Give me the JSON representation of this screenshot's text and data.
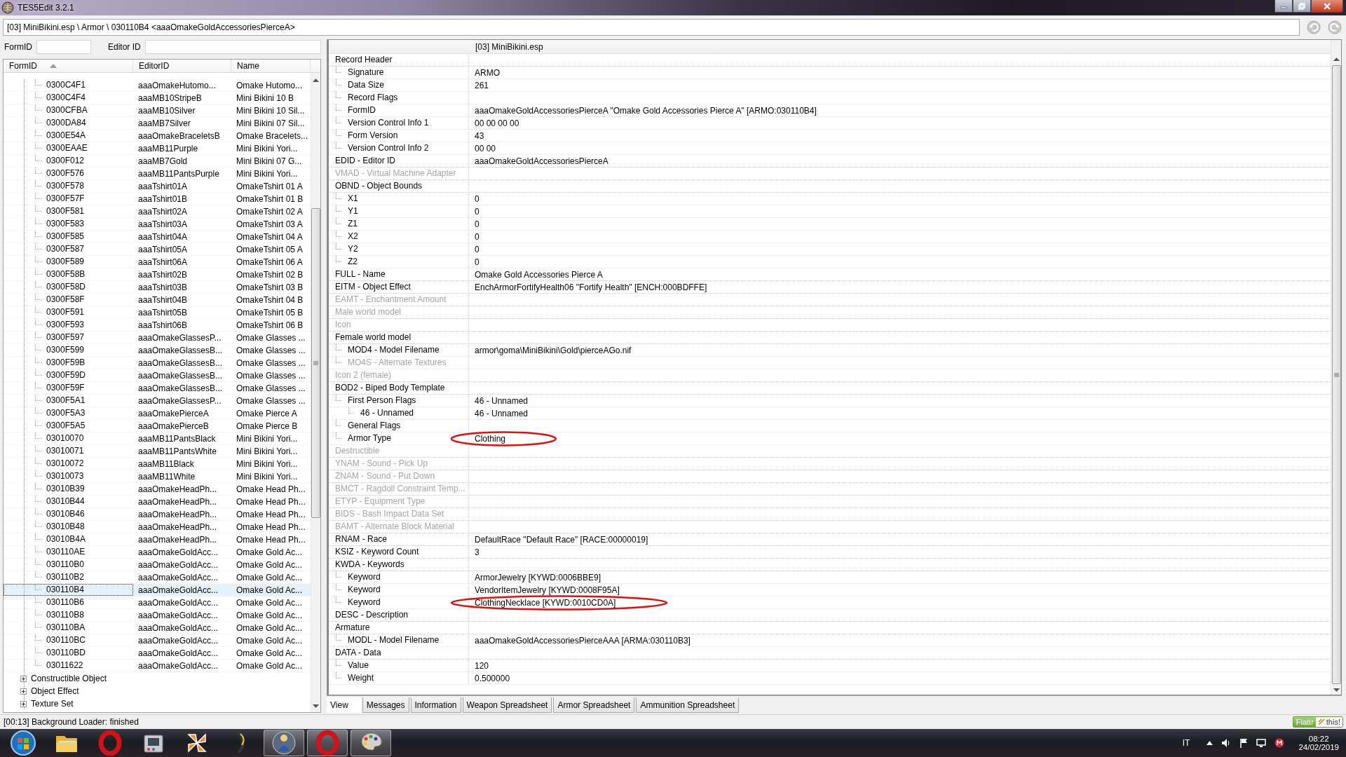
{
  "window": {
    "title": "TES5Edit 3.2.1"
  },
  "path": "[03] MiniBikini.esp \\ Armor \\ 030110B4 <aaaOmakeGoldAccessoriesPierceA>",
  "filters": [
    {
      "label": "FormID"
    },
    {
      "label": "Editor ID"
    }
  ],
  "record_list": {
    "columns": [
      {
        "label": "FormID",
        "sorted": true
      },
      {
        "label": "EditorID",
        "sorted": false
      },
      {
        "label": "Name",
        "sorted": false
      }
    ],
    "rows": [
      {
        "form_id": "0300C4F1",
        "editor_id": "aaaOmakeHutomo...",
        "name": "Omake Hutomo...",
        "selected": false
      },
      {
        "form_id": "0300C4F4",
        "editor_id": "aaaMB10StripeB",
        "name": "Mini Bikini 10 B",
        "selected": false
      },
      {
        "form_id": "0300CFBA",
        "editor_id": "aaaMB10Silver",
        "name": "Mini Bikini 10 Sil...",
        "selected": false
      },
      {
        "form_id": "0300DA84",
        "editor_id": "aaaMB7Silver",
        "name": "Mini Bikini 07 Sil...",
        "selected": false
      },
      {
        "form_id": "0300E54A",
        "editor_id": "aaaOmakeBraceletsB",
        "name": "Omake Bracelets...",
        "selected": false
      },
      {
        "form_id": "0300EAAE",
        "editor_id": "aaaMB11Purple",
        "name": "Mini Bikini Yori...",
        "selected": false
      },
      {
        "form_id": "0300F012",
        "editor_id": "aaaMB7Gold",
        "name": "Mini Bikini 07 G...",
        "selected": false
      },
      {
        "form_id": "0300F576",
        "editor_id": "aaaMB11PantsPurple",
        "name": "Mini Bikini Yori...",
        "selected": false
      },
      {
        "form_id": "0300F578",
        "editor_id": "aaaTshirt01A",
        "name": "OmakeTshirt 01 A",
        "selected": false
      },
      {
        "form_id": "0300F57F",
        "editor_id": "aaaTshirt01B",
        "name": "OmakeTshirt 01 B",
        "selected": false
      },
      {
        "form_id": "0300F581",
        "editor_id": "aaaTshirt02A",
        "name": "OmakeTshirt 02 A",
        "selected": false
      },
      {
        "form_id": "0300F583",
        "editor_id": "aaaTshirt03A",
        "name": "OmakeTshirt 03 A",
        "selected": false
      },
      {
        "form_id": "0300F585",
        "editor_id": "aaaTshirt04A",
        "name": "OmakeTshirt 04 A",
        "selected": false
      },
      {
        "form_id": "0300F587",
        "editor_id": "aaaTshirt05A",
        "name": "OmakeTshirt 05 A",
        "selected": false
      },
      {
        "form_id": "0300F589",
        "editor_id": "aaaTshirt06A",
        "name": "OmakeTshirt 06 A",
        "selected": false
      },
      {
        "form_id": "0300F58B",
        "editor_id": "aaaTshirt02B",
        "name": "OmakeTshirt 02 B",
        "selected": false
      },
      {
        "form_id": "0300F58D",
        "editor_id": "aaaTshirt03B",
        "name": "OmakeTshirt 03 B",
        "selected": false
      },
      {
        "form_id": "0300F58F",
        "editor_id": "aaaTshirt04B",
        "name": "OmakeTshirt 04 B",
        "selected": false
      },
      {
        "form_id": "0300F591",
        "editor_id": "aaaTshirt05B",
        "name": "OmakeTshirt 05 B",
        "selected": false
      },
      {
        "form_id": "0300F593",
        "editor_id": "aaaTshirt06B",
        "name": "OmakeTshirt 06 B",
        "selected": false
      },
      {
        "form_id": "0300F597",
        "editor_id": "aaaOmakeGlassesP...",
        "name": "Omake Glasses ...",
        "selected": false
      },
      {
        "form_id": "0300F599",
        "editor_id": "aaaOmakeGlassesB...",
        "name": "Omake Glasses ...",
        "selected": false
      },
      {
        "form_id": "0300F59B",
        "editor_id": "aaaOmakeGlassesB...",
        "name": "Omake Glasses ...",
        "selected": false
      },
      {
        "form_id": "0300F59D",
        "editor_id": "aaaOmakeGlassesB...",
        "name": "Omake Glasses ...",
        "selected": false
      },
      {
        "form_id": "0300F59F",
        "editor_id": "aaaOmakeGlassesB...",
        "name": "Omake Glasses ...",
        "selected": false
      },
      {
        "form_id": "0300F5A1",
        "editor_id": "aaaOmakeGlassesP...",
        "name": "Omake Glasses ...",
        "selected": false
      },
      {
        "form_id": "0300F5A3",
        "editor_id": "aaaOmakePierceA",
        "name": "Omake Pierce A",
        "selected": false
      },
      {
        "form_id": "0300F5A5",
        "editor_id": "aaaOmakePierceB",
        "name": "Omake Pierce B",
        "selected": false
      },
      {
        "form_id": "03010070",
        "editor_id": "aaaMB11PantsBlack",
        "name": "Mini Bikini Yori...",
        "selected": false
      },
      {
        "form_id": "03010071",
        "editor_id": "aaaMB11PantsWhite",
        "name": "Mini Bikini Yori...",
        "selected": false
      },
      {
        "form_id": "03010072",
        "editor_id": "aaaMB11Black",
        "name": "Mini Bikini Yori...",
        "selected": false
      },
      {
        "form_id": "03010073",
        "editor_id": "aaaMB11White",
        "name": "Mini Bikini Yori...",
        "selected": false
      },
      {
        "form_id": "03010B39",
        "editor_id": "aaaOmakeHeadPh...",
        "name": "Omake Head Ph...",
        "selected": false
      },
      {
        "form_id": "03010B44",
        "editor_id": "aaaOmakeHeadPh...",
        "name": "Omake Head Ph...",
        "selected": false
      },
      {
        "form_id": "03010B46",
        "editor_id": "aaaOmakeHeadPh...",
        "name": "Omake Head Ph...",
        "selected": false
      },
      {
        "form_id": "03010B48",
        "editor_id": "aaaOmakeHeadPh...",
        "name": "Omake Head Ph...",
        "selected": false
      },
      {
        "form_id": "03010B4A",
        "editor_id": "aaaOmakeHeadPh...",
        "name": "Omake Head Ph...",
        "selected": false
      },
      {
        "form_id": "030110AE",
        "editor_id": "aaaOmakeGoldAcc...",
        "name": "Omake Gold Ac...",
        "selected": false
      },
      {
        "form_id": "030110B0",
        "editor_id": "aaaOmakeGoldAcc...",
        "name": "Omake Gold Ac...",
        "selected": false
      },
      {
        "form_id": "030110B2",
        "editor_id": "aaaOmakeGoldAcc...",
        "name": "Omake Gold Ac...",
        "selected": false
      },
      {
        "form_id": "030110B4",
        "editor_id": "aaaOmakeGoldAcc...",
        "name": "Omake Gold Ac...",
        "selected": true
      },
      {
        "form_id": "030110B6",
        "editor_id": "aaaOmakeGoldAcc...",
        "name": "Omake Gold Ac...",
        "selected": false
      },
      {
        "form_id": "030110B8",
        "editor_id": "aaaOmakeGoldAcc...",
        "name": "Omake Gold Ac...",
        "selected": false
      },
      {
        "form_id": "030110BA",
        "editor_id": "aaaOmakeGoldAcc...",
        "name": "Omake Gold Ac...",
        "selected": false
      },
      {
        "form_id": "030110BC",
        "editor_id": "aaaOmakeGoldAcc...",
        "name": "Omake Gold Ac...",
        "selected": false
      },
      {
        "form_id": "030110BD",
        "editor_id": "aaaOmakeGoldAcc...",
        "name": "Omake Gold Ac...",
        "selected": false
      },
      {
        "form_id": "03011622",
        "editor_id": "aaaOmakeGoldAcc...",
        "name": "Omake Gold Ac...",
        "selected": false
      }
    ],
    "groups": [
      {
        "label": "Constructible Object",
        "expanded": false
      },
      {
        "label": "Object Effect",
        "expanded": false
      },
      {
        "label": "Texture Set",
        "expanded": false
      }
    ]
  },
  "record_view": {
    "header": "[03] MiniBikini.esp",
    "fields": [
      {
        "label": "Record Header",
        "disabled": false,
        "children": [
          {
            "label": "Signature",
            "value": "ARMO",
            "disabled": false
          },
          {
            "label": "Data Size",
            "value": "261",
            "disabled": false
          },
          {
            "label": "Record Flags",
            "disabled": false
          },
          {
            "label": "FormID",
            "value": "aaaOmakeGoldAccessoriesPierceA \"Omake Gold Accessories Pierce A\" [ARMO:030110B4]",
            "disabled": false
          },
          {
            "label": "Version Control Info 1",
            "value": "00 00 00 00",
            "disabled": false
          },
          {
            "label": "Form Version",
            "value": "43",
            "disabled": false
          },
          {
            "label": "Version Control Info 2",
            "value": "00 00",
            "disabled": false
          }
        ]
      },
      {
        "label": "EDID - Editor ID",
        "value": "aaaOmakeGoldAccessoriesPierceA",
        "disabled": false
      },
      {
        "label": "VMAD - Virtual Machine Adapter",
        "disabled": true
      },
      {
        "label": "OBND - Object Bounds",
        "disabled": false,
        "children": [
          {
            "label": "X1",
            "value": "0",
            "disabled": false
          },
          {
            "label": "Y1",
            "value": "0",
            "disabled": false
          },
          {
            "label": "Z1",
            "value": "0",
            "disabled": false
          },
          {
            "label": "X2",
            "value": "0",
            "disabled": false
          },
          {
            "label": "Y2",
            "value": "0",
            "disabled": false
          },
          {
            "label": "Z2",
            "value": "0",
            "disabled": false
          }
        ]
      },
      {
        "label": "FULL - Name",
        "value": "Omake Gold Accessories Pierce A",
        "disabled": false
      },
      {
        "label": "EITM - Object Effect",
        "value": "EnchArmorFortifyHealth06 \"Fortify Health\" [ENCH:000BDFFE]",
        "disabled": false
      },
      {
        "label": "EAMT - Enchantment Amount",
        "disabled": true
      },
      {
        "label": "Male world model",
        "disabled": true
      },
      {
        "label": "Icon",
        "disabled": true
      },
      {
        "label": "Female world model",
        "disabled": false,
        "children": [
          {
            "label": "MOD4 - Model Filename",
            "value": "armor\\goma\\MiniBikini\\Gold\\pierceAGo.nif",
            "disabled": false
          },
          {
            "label": "MO4S - Alternate Textures",
            "disabled": true
          }
        ]
      },
      {
        "label": "Icon 2 (female)",
        "disabled": true
      },
      {
        "label": "BOD2 - Biped Body Template",
        "disabled": false,
        "children": [
          {
            "label": "First Person Flags",
            "value": "46 - Unnamed",
            "disabled": false,
            "children": [
              {
                "label": "46 - Unnamed",
                "value": "46 - Unnamed",
                "disabled": false
              }
            ]
          },
          {
            "label": "General Flags",
            "disabled": false
          },
          {
            "label": "Armor Type",
            "value": "Clothing",
            "disabled": false,
            "circled": true
          }
        ]
      },
      {
        "label": "Destructible",
        "disabled": true
      },
      {
        "label": "YNAM - Sound - Pick Up",
        "disabled": true
      },
      {
        "label": "ZNAM - Sound - Put Down",
        "disabled": true
      },
      {
        "label": "BMCT - Ragdoll Constraint Temp...",
        "disabled": true
      },
      {
        "label": "ETYP - Equipment Type",
        "disabled": true
      },
      {
        "label": "BIDS - Bash Impact Data Set",
        "disabled": true
      },
      {
        "label": "BAMT - Alternate Block Material",
        "disabled": true
      },
      {
        "label": "RNAM - Race",
        "value": "DefaultRace \"Default Race\" [RACE:00000019]",
        "disabled": false
      },
      {
        "label": "KSIZ - Keyword Count",
        "value": "3",
        "disabled": false
      },
      {
        "label": "KWDA - Keywords",
        "disabled": false,
        "children": [
          {
            "label": "Keyword",
            "value": "ArmorJewelry [KYWD:0006BBE9]",
            "disabled": false
          },
          {
            "label": "Keyword",
            "value": "VendorItemJewelry [KYWD:0008F95A]",
            "disabled": false
          },
          {
            "label": "Keyword",
            "value": "ClothingNecklace [KYWD:0010CD0A]",
            "disabled": false,
            "circled": true
          }
        ]
      },
      {
        "label": "DESC - Description",
        "disabled": false
      },
      {
        "label": "Armature",
        "disabled": false,
        "children": [
          {
            "label": "MODL - Model Filename",
            "value": "aaaOmakeGoldAccessoriesPierceAAA [ARMA:030110B3]",
            "disabled": false
          }
        ]
      },
      {
        "label": "DATA - Data",
        "disabled": false,
        "children": [
          {
            "label": "Value",
            "value": "120",
            "disabled": false
          },
          {
            "label": "Weight",
            "value": "0.500000",
            "disabled": false
          }
        ]
      }
    ]
  },
  "view_tabs": [
    {
      "label": "View",
      "selected": true
    },
    {
      "label": "Messages",
      "selected": false
    },
    {
      "label": "Information",
      "selected": false
    },
    {
      "label": "Weapon Spreadsheet",
      "selected": false
    },
    {
      "label": "Armor Spreadsheet",
      "selected": false
    },
    {
      "label": "Ammunition Spreadsheet",
      "selected": false
    }
  ],
  "status_bar": {
    "message": "[00:13] Background Loader: finished",
    "flattr": "Flattr",
    "flattr_suffix": "this!"
  },
  "taskbar": {
    "apps": [
      {
        "kind": "start",
        "active": false
      },
      {
        "kind": "folder",
        "active": false
      },
      {
        "kind": "ring",
        "active": false
      },
      {
        "kind": "device",
        "active": false
      },
      {
        "kind": "pinwheel",
        "active": false
      },
      {
        "kind": "crescent",
        "active": false
      },
      {
        "kind": "figure",
        "active": true
      },
      {
        "kind": "ring",
        "active": true
      },
      {
        "kind": "palette",
        "active": true
      }
    ],
    "language": "IT",
    "time": "08:22",
    "date": "24/02/2019"
  }
}
